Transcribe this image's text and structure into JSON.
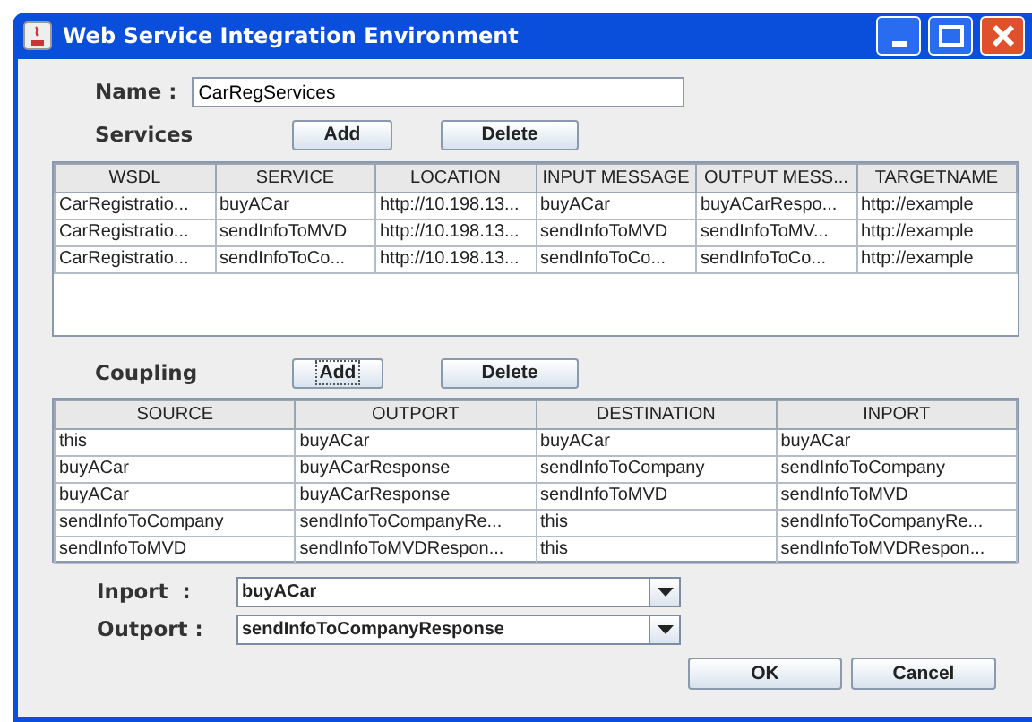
{
  "window": {
    "title": "Web Service Integration Environment"
  },
  "name_field": {
    "label": "Name :",
    "value": "CarRegServices"
  },
  "services": {
    "label": "Services",
    "buttons": [
      {
        "label": "Add",
        "focused": false
      },
      {
        "label": "Delete",
        "focused": false
      }
    ],
    "table": {
      "columns": [
        "WSDL",
        "SERVICE",
        "LOCATION",
        "INPUT MESSAGE",
        "OUTPUT MESS...",
        "TARGETNAME"
      ],
      "rows": [
        [
          "CarRegistratio...",
          "buyACar",
          "http://10.198.13...",
          "buyACar",
          "buyACarRespo...",
          "http://example"
        ],
        [
          "CarRegistratio...",
          "sendInfoToMVD",
          "http://10.198.13...",
          "sendInfoToMVD",
          "sendInfoToMV...",
          "http://example"
        ],
        [
          "CarRegistratio...",
          "sendInfoToCo...",
          "http://10.198.13...",
          "sendInfoToCo...",
          "sendInfoToCo...",
          "http://example"
        ]
      ]
    }
  },
  "coupling": {
    "label": "Coupling",
    "buttons": [
      {
        "label": "Add",
        "focused": true
      },
      {
        "label": "Delete",
        "focused": false
      }
    ],
    "table": {
      "columns": [
        "SOURCE",
        "OUTPORT",
        "DESTINATION",
        "INPORT"
      ],
      "rows": [
        [
          "this",
          "buyACar",
          "buyACar",
          "buyACar"
        ],
        [
          "buyACar",
          "buyACarResponse",
          "sendInfoToCompany",
          "sendInfoToCompany"
        ],
        [
          "buyACar",
          "buyACarResponse",
          "sendInfoToMVD",
          "sendInfoToMVD"
        ],
        [
          "sendInfoToCompany",
          "sendInfoToCompanyRe...",
          "this",
          "sendInfoToCompanyRe..."
        ],
        [
          "sendInfoToMVD",
          "sendInfoToMVDRespon...",
          "this",
          "sendInfoToMVDRespon..."
        ]
      ]
    }
  },
  "ports": [
    {
      "label": "Inport  :",
      "value": "buyACar"
    },
    {
      "label": "Outport :",
      "value": "sendInfoToCompanyResponse"
    }
  ],
  "buttons": [
    {
      "label": "OK"
    },
    {
      "label": "Cancel"
    }
  ]
}
